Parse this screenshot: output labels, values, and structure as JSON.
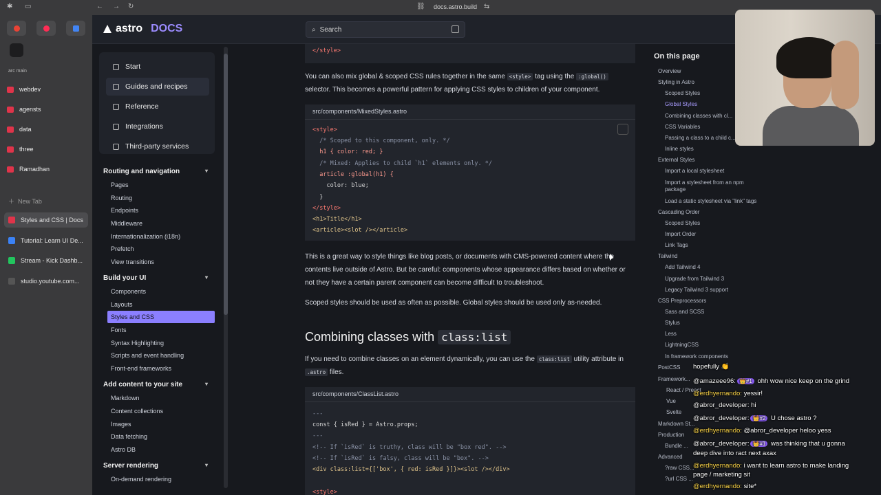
{
  "browser": {
    "url": "docs.astro.build",
    "arc_space_label": "arc main",
    "folders": [
      "webdev",
      "agensts",
      "data",
      "three",
      "Ramadhan"
    ],
    "new_tab": "New Tab",
    "tabs": [
      {
        "title": "Styles and CSS | Docs",
        "color": "#e0344a"
      },
      {
        "title": "Tutorial: Learn UI De...",
        "color": "#3b82f6"
      },
      {
        "title": "Stream - Kick Dashb...",
        "color": "#22c55e"
      },
      {
        "title": "studio.youtube.com...",
        "color": "#555555"
      }
    ]
  },
  "header": {
    "logo_word": "astro",
    "logo_docs": "DOCS",
    "search_placeholder": "Search"
  },
  "nav": {
    "top": [
      "Start",
      "Guides and recipes",
      "Reference",
      "Integrations",
      "Third-party services"
    ],
    "sections": [
      {
        "title": "Routing and navigation",
        "items": [
          "Pages",
          "Routing",
          "Endpoints",
          "Middleware",
          "Internationalization (i18n)",
          "Prefetch",
          "View transitions"
        ]
      },
      {
        "title": "Build your UI",
        "items": [
          "Components",
          "Layouts",
          "Styles and CSS",
          "Fonts",
          "Syntax Highlighting",
          "Scripts and event handling",
          "Front-end frameworks"
        ]
      },
      {
        "title": "Add content to your site",
        "items": [
          "Markdown",
          "Content collections",
          "Images",
          "Data fetching",
          "Astro DB"
        ]
      },
      {
        "title": "Server rendering",
        "items": [
          "On-demand rendering"
        ]
      }
    ]
  },
  "content": {
    "style_close": "</style>",
    "p1a": "You can also mix global & scoped CSS rules together in the same",
    "p1_code1": "<style>",
    "p1b": "tag using the",
    "p1_code2": ":global()",
    "p1c": "selector. This becomes a powerful pattern for applying CSS styles to children of your component.",
    "code1_file": "src/components/MixedStyles.astro",
    "code1": [
      "<style>",
      "  /* Scoped to this component, only. */",
      "  h1 { color: red; }",
      "  /* Mixed: Applies to child `h1` elements only. */",
      "  article :global(h1) {",
      "    color: blue;",
      "  }",
      "</style>",
      "<h1>Title</h1>",
      "<article><slot /></article>"
    ],
    "p2": "This is a great way to style things like blog posts, or documents with CMS-powered content where the contents live outside of Astro. But be careful: components whose appearance differs based on whether or not they have a certain parent component can become difficult to troubleshoot.",
    "p3": "Scoped styles should be used as often as possible. Global styles should be used only as-needed.",
    "h2_text": "Combining classes with",
    "h2_code": "class:list",
    "p4a": "If you need to combine classes on an element dynamically, you can use the",
    "p4_code": "class:list",
    "p4b": "utility attribute in",
    "p4_code2": ".astro",
    "p4c": "files.",
    "code2_file": "src/components/ClassList.astro",
    "code2": [
      "---",
      "const { isRed } = Astro.props;",
      "---",
      "<!-- If `isRed` is truthy, class will be \"box red\". -->",
      "<!-- If `isRed` is falsy, class will be \"box\". -->",
      "<div class:list={['box', { red: isRed }]}><slot /></div>",
      "",
      "<style>"
    ]
  },
  "toc": {
    "heading": "On this page",
    "items": [
      {
        "t": "Overview",
        "lvl": 0
      },
      {
        "t": "Styling in Astro",
        "lvl": 0
      },
      {
        "t": "Scoped Styles",
        "lvl": 1
      },
      {
        "t": "Global Styles",
        "lvl": 1,
        "on": true
      },
      {
        "t": "Combining classes with cl...",
        "lvl": 1
      },
      {
        "t": "CSS Variables",
        "lvl": 1
      },
      {
        "t": "Passing a class to a child c...",
        "lvl": 1
      },
      {
        "t": "Inline styles",
        "lvl": 1
      },
      {
        "t": "External Styles",
        "lvl": 0
      },
      {
        "t": "Import a local stylesheet",
        "lvl": 1
      },
      {
        "t": "Import a stylesheet from an npm",
        "lvl": 1
      },
      {
        "t": "package",
        "lvl": 1
      },
      {
        "t": "Load a static stylesheet via \"link\" tags",
        "lvl": 1
      },
      {
        "t": "Cascading Order",
        "lvl": 0
      },
      {
        "t": "Scoped Styles",
        "lvl": 1
      },
      {
        "t": "Import Order",
        "lvl": 1
      },
      {
        "t": "Link Tags",
        "lvl": 1
      },
      {
        "t": "Tailwind",
        "lvl": 0
      },
      {
        "t": "Add Tailwind 4",
        "lvl": 1
      },
      {
        "t": "Upgrade from Tailwind 3",
        "lvl": 1
      },
      {
        "t": "Legacy Tailwind 3 support",
        "lvl": 1
      },
      {
        "t": "CSS Preprocessors",
        "lvl": 0
      },
      {
        "t": "Sass and SCSS",
        "lvl": 1
      },
      {
        "t": "Stylus",
        "lvl": 1
      },
      {
        "t": "Less",
        "lvl": 1
      },
      {
        "t": "LightningCSS",
        "lvl": 1
      },
      {
        "t": "In framework components",
        "lvl": 1
      },
      {
        "t": "PostCSS",
        "lvl": 0
      },
      {
        "t": "Framework...",
        "lvl": 0
      },
      {
        "t": "React / Preact",
        "lvl": 1
      },
      {
        "t": "Vue",
        "lvl": 1
      },
      {
        "t": "Svelte",
        "lvl": 1
      },
      {
        "t": "Markdown St...",
        "lvl": 0
      },
      {
        "t": "Production",
        "lvl": 0
      },
      {
        "t": "Bundle ...",
        "lvl": 1
      },
      {
        "t": "Advanced",
        "lvl": 0
      },
      {
        "t": "?raw CSS...",
        "lvl": 1
      },
      {
        "t": "?url CSS ...",
        "lvl": 1
      }
    ]
  },
  "chat": [
    {
      "user": "",
      "text": "hopefully 👏",
      "y": 0
    },
    {
      "user": "@amazeee96:",
      "badge": "👑#1",
      "text": "ohh wow nice keep on the grind",
      "color": "white"
    },
    {
      "user": "@erdhyernando:",
      "text": "yessir!",
      "color": "yellow"
    },
    {
      "user": "@abror_developer:",
      "text": "hi",
      "color": "white"
    },
    {
      "user": "@abror_developer:",
      "badge": "👑#2",
      "text": "U chose astro ?",
      "color": "white"
    },
    {
      "user": "@erdhyernando:",
      "text": "@abror_developer heloo yess",
      "color": "yellow"
    },
    {
      "user": "@abror_developer:",
      "badge": "👑#1",
      "text": "was thinking that u gonna",
      "color": "white"
    },
    {
      "user": "",
      "text": "deep dive into ract next axax",
      "color": "white"
    },
    {
      "user": "@erdhyernando:",
      "text": "i want to learn astro to make landing",
      "color": "yellow"
    },
    {
      "user": "",
      "text": "page / marketing sit",
      "color": "white"
    },
    {
      "user": "@erdhyernando:",
      "text": "site*",
      "color": "yellow"
    }
  ]
}
